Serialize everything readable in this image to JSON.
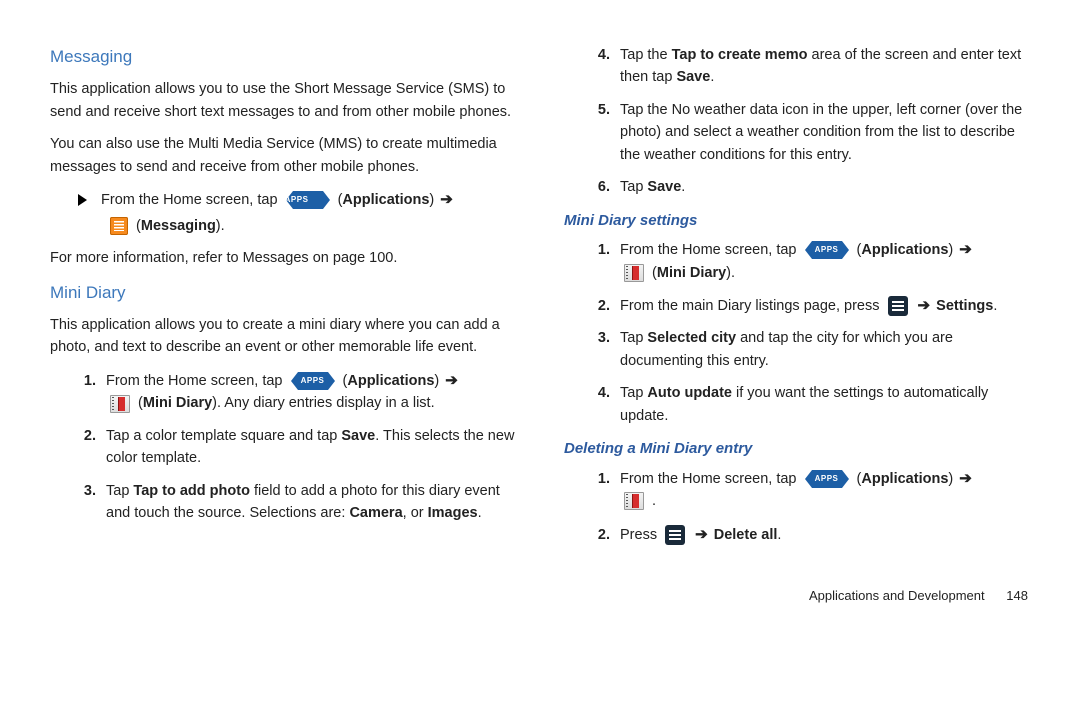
{
  "icons": {
    "apps_label": "APPS"
  },
  "left": {
    "h_messaging": "Messaging",
    "msg_p1": "This application allows you to use the Short Message Service (SMS) to send and receive short text messages to and from other mobile phones.",
    "msg_p2": "You can also use the Multi Media Service (MMS) to create multimedia messages to send and receive from other mobile phones.",
    "msg_from": "From the Home screen, tap ",
    "applications": "Applications",
    "messaging": "Messaging",
    "msg_ref_a": "For more information, refer to ",
    "msg_ref_b": "Messages",
    "msg_ref_c": " on page 100.",
    "h_minidiary": "Mini Diary",
    "md_intro": "This application allows you to create a mini diary where you can add a photo, and text to describe an event or other memorable life event.",
    "md1_a": "From the Home screen, tap ",
    "md1_b": "Mini Diary",
    "md1_c": ". Any diary entries display in a list.",
    "md2_a": "Tap a color template square and tap ",
    "md2_b": "Save",
    "md2_c": ". This selects the new color template.",
    "md3_a": "Tap ",
    "md3_b": "Tap to add photo",
    "md3_c": " field to add a photo for this diary event and touch the source. Selections are: ",
    "md3_d": "Camera",
    "md3_e": ", or ",
    "md3_f": "Images",
    "md3_g": "."
  },
  "right": {
    "s4_a": "Tap the ",
    "s4_b": "Tap to create memo",
    "s4_c": " area of the screen and enter text then tap ",
    "s4_d": "Save",
    "s4_e": ".",
    "s5": "Tap the No weather data icon in the upper, left corner (over the photo) and select a weather condition from the list to describe the weather conditions for this entry.",
    "s6_a": "Tap ",
    "s6_b": "Save",
    "s6_c": ".",
    "h_settings": "Mini Diary settings",
    "set1_a": "From the Home screen, tap ",
    "set1_b": "Mini Diary",
    "set1_c": ".",
    "set2_a": "From the main Diary listings page, press ",
    "set2_b": "Settings",
    "set2_c": ".",
    "set3_a": "Tap ",
    "set3_b": "Selected city",
    "set3_c": " and tap the city for which you are documenting this entry.",
    "set4_a": "Tap ",
    "set4_b": "Auto update",
    "set4_c": " if you want the settings to automatically update.",
    "h_delete": "Deleting a Mini Diary entry",
    "del1_a": "From the Home screen, tap ",
    "del2_a": "Press ",
    "del2_b": "Delete all",
    "del2_c": "."
  },
  "footer": {
    "section": "Applications and Development",
    "page": "148"
  }
}
